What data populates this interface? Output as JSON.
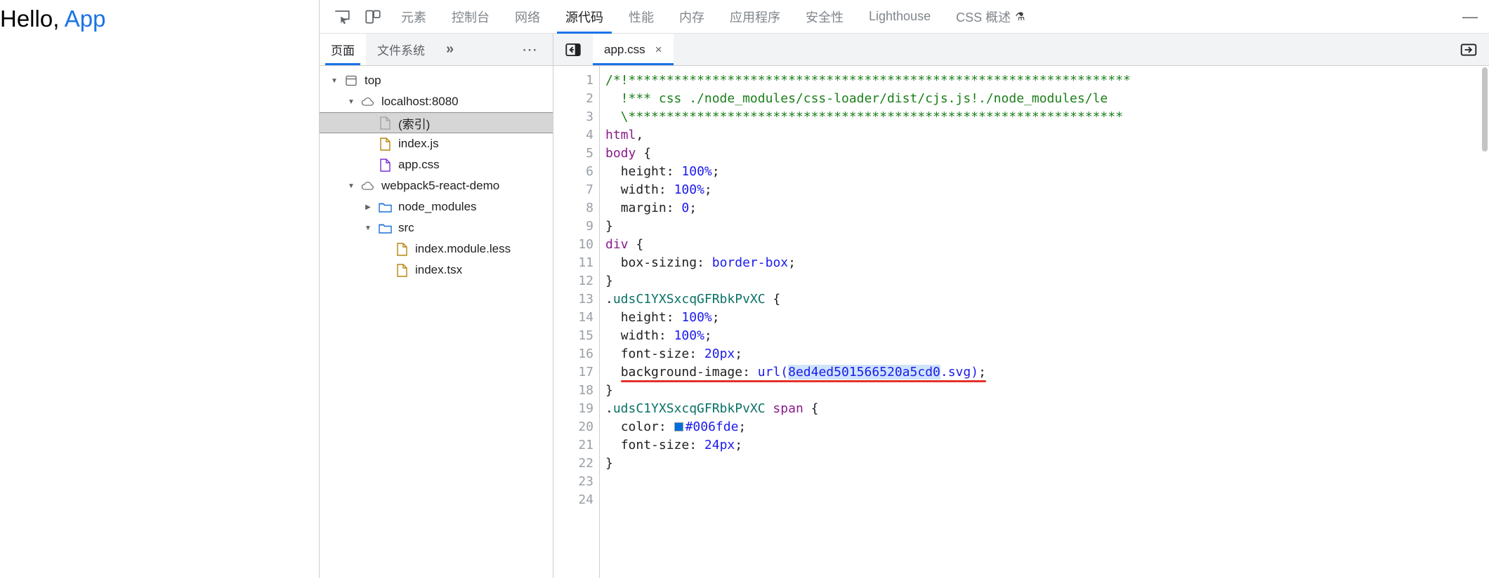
{
  "page": {
    "greeting_prefix": "Hello, ",
    "greeting_app": "App",
    "app_color": "#1a73e8"
  },
  "devtools": {
    "toolbar": {
      "inspect_icon": "inspect-element-icon",
      "device_icon": "device-toolbar-icon",
      "minimize_label": "—",
      "tabs": [
        {
          "label": "元素",
          "active": false
        },
        {
          "label": "控制台",
          "active": false
        },
        {
          "label": "网络",
          "active": false
        },
        {
          "label": "源代码",
          "active": true
        },
        {
          "label": "性能",
          "active": false
        },
        {
          "label": "内存",
          "active": false
        },
        {
          "label": "应用程序",
          "active": false
        },
        {
          "label": "安全性",
          "active": false
        },
        {
          "label": "Lighthouse",
          "active": false
        },
        {
          "label": "CSS 概述",
          "active": false,
          "flask": "⚗"
        }
      ]
    },
    "navigator": {
      "tabs": [
        {
          "label": "页面",
          "active": true
        },
        {
          "label": "文件系统",
          "active": false
        }
      ],
      "overflow_label": "»",
      "more_label": "⋯",
      "tree": [
        {
          "indent": 0,
          "arrow": "down",
          "icon": "frame-icon",
          "label": "top",
          "selected": false
        },
        {
          "indent": 1,
          "arrow": "down",
          "icon": "cloud-icon",
          "label": "localhost:8080",
          "selected": false
        },
        {
          "indent": 2,
          "arrow": "none",
          "icon": "doc-gray",
          "label": "(索引)",
          "selected": true
        },
        {
          "indent": 2,
          "arrow": "none",
          "icon": "doc-yellow",
          "label": "index.js",
          "selected": false
        },
        {
          "indent": 2,
          "arrow": "none",
          "icon": "doc-purple",
          "label": "app.css",
          "selected": false
        },
        {
          "indent": 1,
          "arrow": "down",
          "icon": "cloud-icon",
          "label": "webpack5-react-demo",
          "selected": false
        },
        {
          "indent": 2,
          "arrow": "right",
          "icon": "folder-blue",
          "label": "node_modules",
          "selected": false
        },
        {
          "indent": 2,
          "arrow": "down",
          "icon": "folder-blue",
          "label": "src",
          "selected": false
        },
        {
          "indent": 3,
          "arrow": "none",
          "icon": "doc-yellow",
          "label": "index.module.less",
          "selected": false
        },
        {
          "indent": 3,
          "arrow": "none",
          "icon": "doc-yellow",
          "label": "index.tsx",
          "selected": false
        }
      ]
    },
    "source": {
      "back_icon": "back-panel-icon",
      "forward_icon": "show-navigator-icon",
      "tab_label": "app.css",
      "tab_close": "×",
      "line_numbers": [
        "1",
        "2",
        "3",
        "4",
        "5",
        "6",
        "7",
        "8",
        "9",
        "10",
        "11",
        "12",
        "13",
        "14",
        "15",
        "16",
        "17",
        "18",
        "19",
        "20",
        "21",
        "22",
        "23",
        "24"
      ],
      "highlight_hash": "8ed4ed501566520a5cd0",
      "color_swatch": "#006fde",
      "annotation_color": "#e4322b",
      "class_name": ".udsC1YXSxcqGFRbkPvXC",
      "lines": [
        "/*!******************************************************************",
        "  !*** css ./node_modules/css-loader/dist/cjs.js!./node_modules/le",
        "  \\*****************************************************************",
        "html,",
        "body {",
        "  height: 100%;",
        "  width: 100%;",
        "  margin: 0;",
        "}",
        "div {",
        "  box-sizing: border-box;",
        "}",
        ".udsC1YXSxcqGFRbkPvXC {",
        "  height: 100%;",
        "  width: 100%;",
        "  font-size: 20px;",
        "  background-image: url(8ed4ed501566520a5cd0.svg);",
        "}",
        ".udsC1YXSxcqGFRbkPvXC span {",
        "  color: #006fde;",
        "  font-size: 24px;",
        "}",
        "",
        ""
      ]
    }
  }
}
